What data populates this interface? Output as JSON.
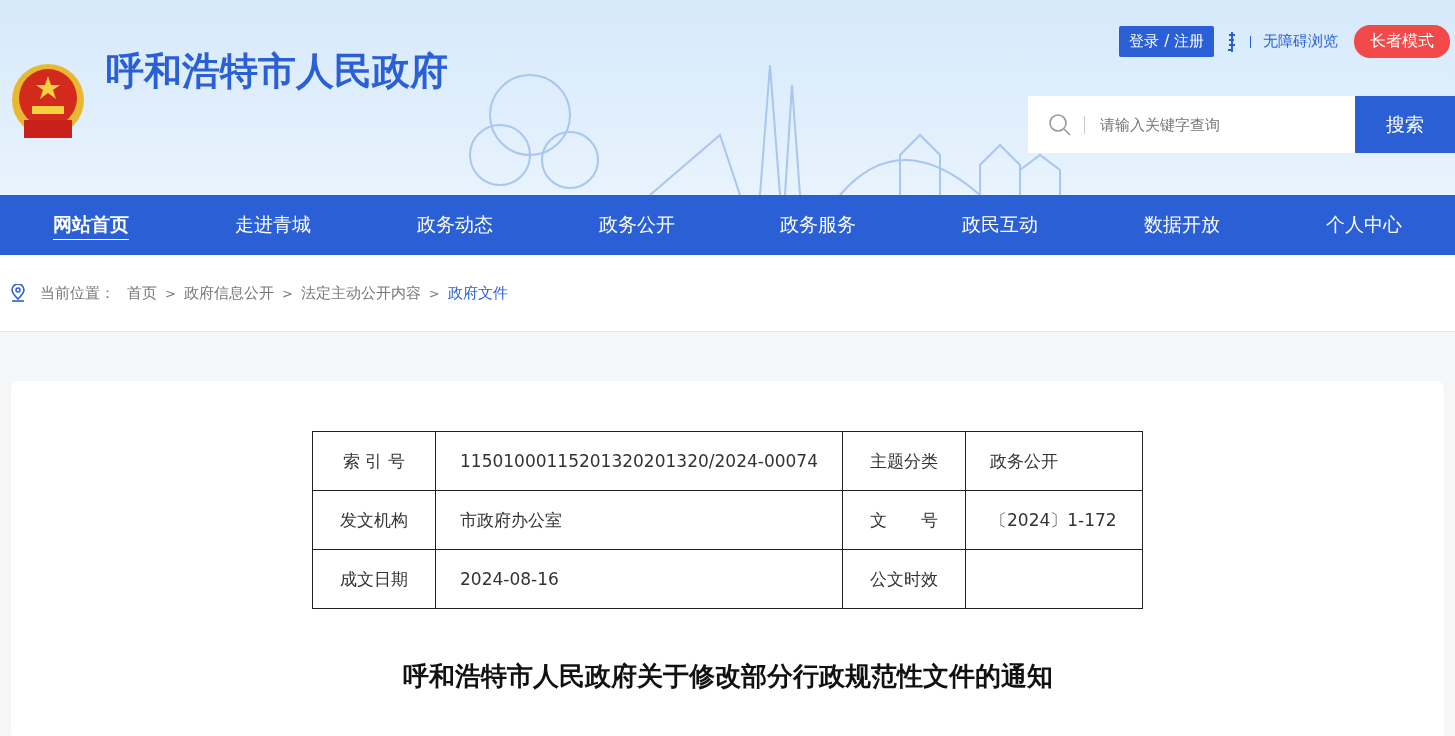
{
  "header": {
    "site_title": "呼和浩特市人民政府",
    "login": "登录 / 注册",
    "accessibility": "无障碍浏览",
    "elder_mode": "长者模式"
  },
  "search": {
    "placeholder": "请输入关键字查询",
    "button": "搜索"
  },
  "nav": [
    {
      "label": "网站首页",
      "selected": true
    },
    {
      "label": "走进青城",
      "selected": false
    },
    {
      "label": "政务动态",
      "selected": false
    },
    {
      "label": "政务公开",
      "selected": false
    },
    {
      "label": "政务服务",
      "selected": false
    },
    {
      "label": "政民互动",
      "selected": false
    },
    {
      "label": "数据开放",
      "selected": false
    },
    {
      "label": "个人中心",
      "selected": false
    }
  ],
  "breadcrumb": {
    "label": "当前位置：",
    "separator": ">",
    "items": [
      {
        "label": "首页",
        "selected": false
      },
      {
        "label": "政府信息公开",
        "selected": false
      },
      {
        "label": "法定主动公开内容",
        "selected": false
      },
      {
        "label": "政府文件",
        "selected": true
      }
    ]
  },
  "info_table": [
    [
      "索 引 号",
      "11501000115201320201320/2024-00074",
      "主题分类",
      "政务公开"
    ],
    [
      "发文机构",
      "市政府办公室",
      "文　　号",
      "〔2024〕1-172"
    ],
    [
      "成文日期",
      "2024-08-16",
      "公文时效"
    ]
  ],
  "document_title": "呼和浩特市人民政府关于修改部分行政规范性文件的通知"
}
